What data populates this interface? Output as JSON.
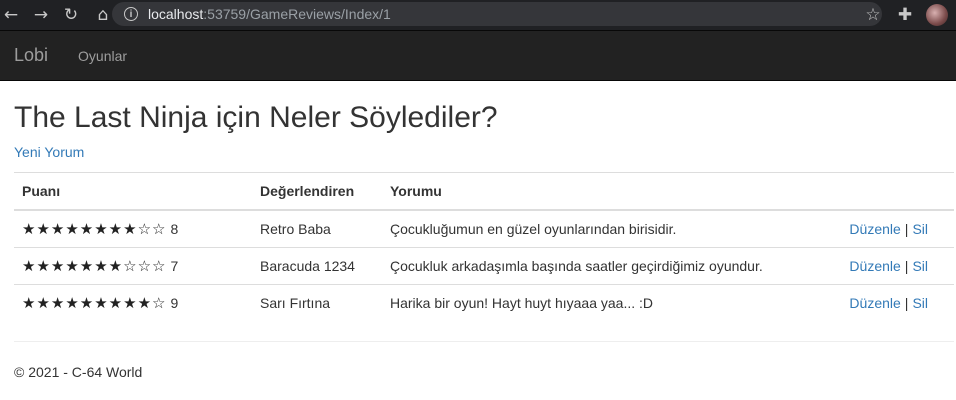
{
  "browser": {
    "url_host": "localhost",
    "url_rest": ":53759/GameReviews/Index/1"
  },
  "navbar": {
    "brand": "Lobi",
    "link": "Oyunlar"
  },
  "page": {
    "title": "The Last Ninja için Neler Söylediler?",
    "new_link": "Yeni Yorum",
    "columns": [
      "Puanı",
      "Değerlendiren",
      "Yorumu"
    ],
    "max_rating": 10,
    "edit_label": "Düzenle",
    "separator": "|",
    "delete_label": "Sil",
    "rows": [
      {
        "rating": 8,
        "rating_text": "8",
        "reviewer": "Retro Baba",
        "comment": "Çocukluğumun en güzel oyunlarından birisidir."
      },
      {
        "rating": 7,
        "rating_text": "7",
        "reviewer": "Baracuda 1234",
        "comment": "Çocukluk arkadaşımla başında saatler geçirdiğimiz oyundur."
      },
      {
        "rating": 9,
        "rating_text": "9",
        "reviewer": "Sarı Fırtına",
        "comment": "Harika bir oyun! Hayt huyt hıyaaa yaa... :D"
      }
    ]
  },
  "footer": {
    "text": "© 2021 - C-64 World"
  }
}
